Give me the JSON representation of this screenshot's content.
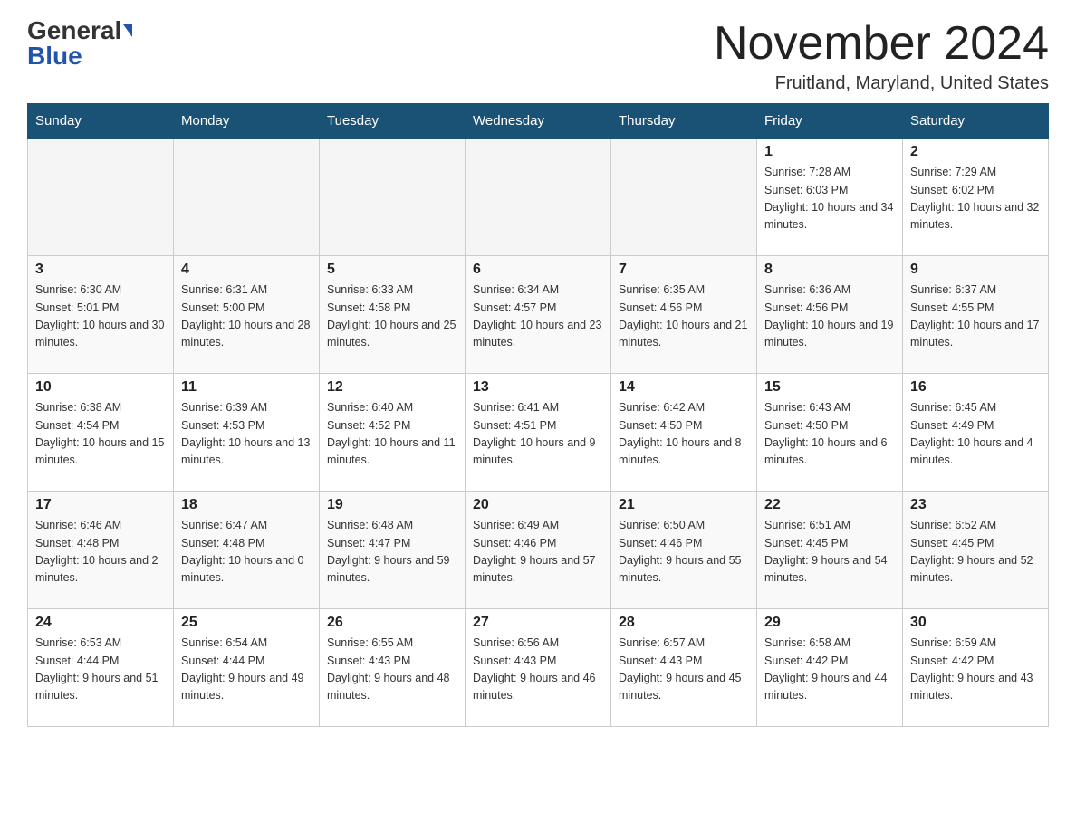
{
  "header": {
    "logo_general": "General",
    "logo_blue": "Blue",
    "month_title": "November 2024",
    "location": "Fruitland, Maryland, United States"
  },
  "days_of_week": [
    "Sunday",
    "Monday",
    "Tuesday",
    "Wednesday",
    "Thursday",
    "Friday",
    "Saturday"
  ],
  "weeks": [
    [
      {
        "day": "",
        "info": ""
      },
      {
        "day": "",
        "info": ""
      },
      {
        "day": "",
        "info": ""
      },
      {
        "day": "",
        "info": ""
      },
      {
        "day": "",
        "info": ""
      },
      {
        "day": "1",
        "info": "Sunrise: 7:28 AM\nSunset: 6:03 PM\nDaylight: 10 hours and 34 minutes."
      },
      {
        "day": "2",
        "info": "Sunrise: 7:29 AM\nSunset: 6:02 PM\nDaylight: 10 hours and 32 minutes."
      }
    ],
    [
      {
        "day": "3",
        "info": "Sunrise: 6:30 AM\nSunset: 5:01 PM\nDaylight: 10 hours and 30 minutes."
      },
      {
        "day": "4",
        "info": "Sunrise: 6:31 AM\nSunset: 5:00 PM\nDaylight: 10 hours and 28 minutes."
      },
      {
        "day": "5",
        "info": "Sunrise: 6:33 AM\nSunset: 4:58 PM\nDaylight: 10 hours and 25 minutes."
      },
      {
        "day": "6",
        "info": "Sunrise: 6:34 AM\nSunset: 4:57 PM\nDaylight: 10 hours and 23 minutes."
      },
      {
        "day": "7",
        "info": "Sunrise: 6:35 AM\nSunset: 4:56 PM\nDaylight: 10 hours and 21 minutes."
      },
      {
        "day": "8",
        "info": "Sunrise: 6:36 AM\nSunset: 4:56 PM\nDaylight: 10 hours and 19 minutes."
      },
      {
        "day": "9",
        "info": "Sunrise: 6:37 AM\nSunset: 4:55 PM\nDaylight: 10 hours and 17 minutes."
      }
    ],
    [
      {
        "day": "10",
        "info": "Sunrise: 6:38 AM\nSunset: 4:54 PM\nDaylight: 10 hours and 15 minutes."
      },
      {
        "day": "11",
        "info": "Sunrise: 6:39 AM\nSunset: 4:53 PM\nDaylight: 10 hours and 13 minutes."
      },
      {
        "day": "12",
        "info": "Sunrise: 6:40 AM\nSunset: 4:52 PM\nDaylight: 10 hours and 11 minutes."
      },
      {
        "day": "13",
        "info": "Sunrise: 6:41 AM\nSunset: 4:51 PM\nDaylight: 10 hours and 9 minutes."
      },
      {
        "day": "14",
        "info": "Sunrise: 6:42 AM\nSunset: 4:50 PM\nDaylight: 10 hours and 8 minutes."
      },
      {
        "day": "15",
        "info": "Sunrise: 6:43 AM\nSunset: 4:50 PM\nDaylight: 10 hours and 6 minutes."
      },
      {
        "day": "16",
        "info": "Sunrise: 6:45 AM\nSunset: 4:49 PM\nDaylight: 10 hours and 4 minutes."
      }
    ],
    [
      {
        "day": "17",
        "info": "Sunrise: 6:46 AM\nSunset: 4:48 PM\nDaylight: 10 hours and 2 minutes."
      },
      {
        "day": "18",
        "info": "Sunrise: 6:47 AM\nSunset: 4:48 PM\nDaylight: 10 hours and 0 minutes."
      },
      {
        "day": "19",
        "info": "Sunrise: 6:48 AM\nSunset: 4:47 PM\nDaylight: 9 hours and 59 minutes."
      },
      {
        "day": "20",
        "info": "Sunrise: 6:49 AM\nSunset: 4:46 PM\nDaylight: 9 hours and 57 minutes."
      },
      {
        "day": "21",
        "info": "Sunrise: 6:50 AM\nSunset: 4:46 PM\nDaylight: 9 hours and 55 minutes."
      },
      {
        "day": "22",
        "info": "Sunrise: 6:51 AM\nSunset: 4:45 PM\nDaylight: 9 hours and 54 minutes."
      },
      {
        "day": "23",
        "info": "Sunrise: 6:52 AM\nSunset: 4:45 PM\nDaylight: 9 hours and 52 minutes."
      }
    ],
    [
      {
        "day": "24",
        "info": "Sunrise: 6:53 AM\nSunset: 4:44 PM\nDaylight: 9 hours and 51 minutes."
      },
      {
        "day": "25",
        "info": "Sunrise: 6:54 AM\nSunset: 4:44 PM\nDaylight: 9 hours and 49 minutes."
      },
      {
        "day": "26",
        "info": "Sunrise: 6:55 AM\nSunset: 4:43 PM\nDaylight: 9 hours and 48 minutes."
      },
      {
        "day": "27",
        "info": "Sunrise: 6:56 AM\nSunset: 4:43 PM\nDaylight: 9 hours and 46 minutes."
      },
      {
        "day": "28",
        "info": "Sunrise: 6:57 AM\nSunset: 4:43 PM\nDaylight: 9 hours and 45 minutes."
      },
      {
        "day": "29",
        "info": "Sunrise: 6:58 AM\nSunset: 4:42 PM\nDaylight: 9 hours and 44 minutes."
      },
      {
        "day": "30",
        "info": "Sunrise: 6:59 AM\nSunset: 4:42 PM\nDaylight: 9 hours and 43 minutes."
      }
    ]
  ]
}
